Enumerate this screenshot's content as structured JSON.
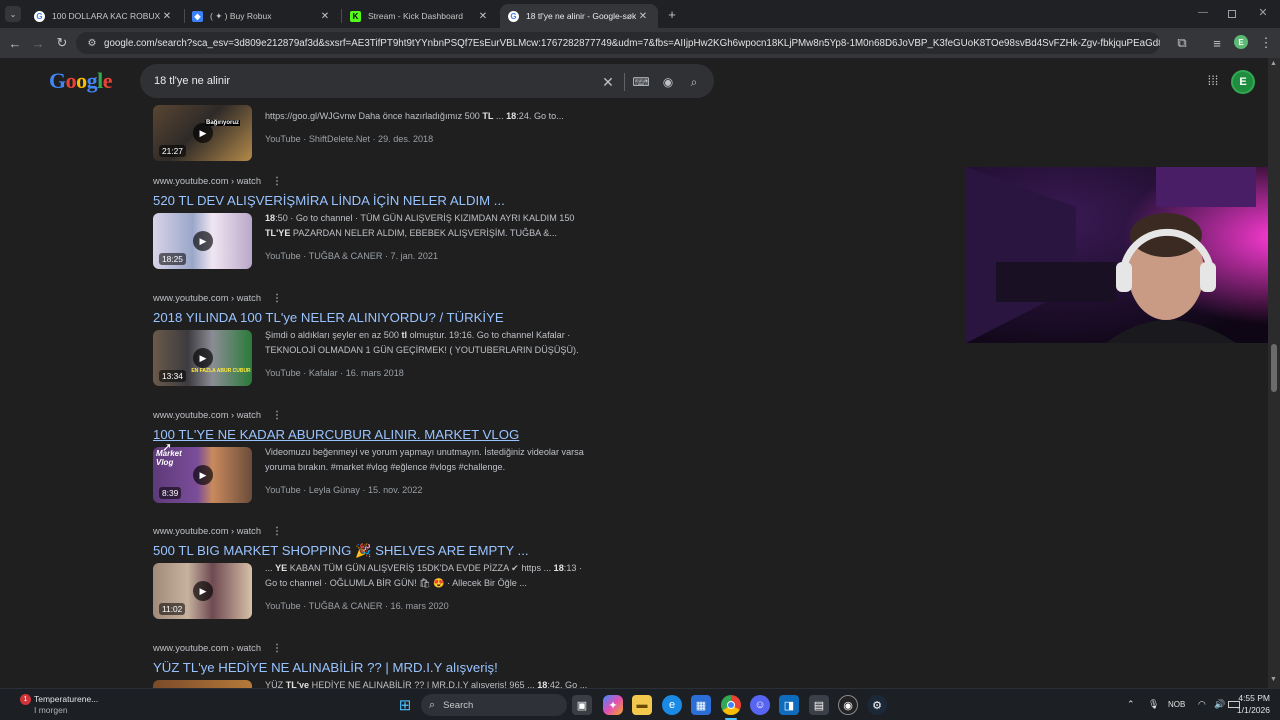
{
  "browser": {
    "tabs": [
      {
        "title": "100 DOLLARA KAC ROBUX ALIN",
        "active": false
      },
      {
        "title": "( ✦ ) Buy Robux",
        "active": false
      },
      {
        "title": "Stream - Kick Dashboard",
        "active": false
      },
      {
        "title": "18 tl'ye ne alinir - Google-søk",
        "active": true
      }
    ],
    "url": "google.com/search?sca_esv=3d809e212879af3d&sxsrf=AE3TifPT9ht9tYYnbnPSQf7EsEurVBLMcw:1767282877749&udm=7&fbs=AIIjpHw2KGh6wpocn18KLjPMw8n5Yp8-1M0n68D6JoVBP_K3feGUoK8TOe98svBd4SvFZHk-Zgv-fbkjquPEaGd8Tf9HQ0lH8...",
    "profile_initial": "E"
  },
  "google": {
    "logo": "Google",
    "query": "18 tl'ye ne alinir"
  },
  "results": [
    {
      "snippet_html": "https://goo.gl/WJGvnw Daha önce hazırladığımız 500 <b>TL</b> ... <b>18</b>:24. Go to...",
      "channel": "YouTube · ShiftDelete.Net · 29. des. 2018",
      "duration": "21:27",
      "thumb_label": "Bağırıyoruz"
    },
    {
      "source": "www.youtube.com › watch",
      "title": "520 TL DEV ALIŞVERİŞMİRA LİNDA İÇİN NELER ALDIM ...",
      "snippet_html": "<b>18</b>:50 · Go to channel · TÜM GÜN ALIŞVERİŞ KIZIMDAN AYRI KALDIM 150 <b>TL'YE</b> PAZARDAN NELER ALDIM, EBEBEK ALIŞVERİŞİM. TUĞBA &...",
      "channel": "YouTube · TUĞBA &amp; CANER · 7. jan. 2021",
      "duration": "18:25"
    },
    {
      "source": "www.youtube.com › watch",
      "title": "2018 YILINDA 100 TL'ye NELER ALINIYORDU? / TÜRKİYE",
      "snippet_html": "Şimdi o aldıkları şeyler en az 500 <b>tl</b> olmuştur. 19:16. Go to channel Kafalar · TEKNOLOJİ OLMADAN 1 GÜN GEÇİRMEK! ( YOUTUBERLARIN DÜŞÜŞÜ).",
      "channel": "YouTube · Kafalar · 16. mars 2018",
      "duration": "13:34",
      "thumb_label": "EN FAZLA ABUR CUBUR"
    },
    {
      "source": "www.youtube.com › watch",
      "title": "100 TL'YE NE KADAR ABURCUBUR ALINIR. MARKET VLOG",
      "snippet_html": "Videomuzu beğenmeyi ve yorum yapmayı unutmayın. İstediğiniz videolar varsa yoruma bırakın. #market #vlog #eğlence #vlogs #challenge.",
      "channel": "YouTube · Leyla Günay · 15. nov. 2022",
      "duration": "8:39",
      "thumb_label": "Market Vlog"
    },
    {
      "source": "www.youtube.com › watch",
      "title": "500 TL BIG MARKET SHOPPING 🎉 SHELVES ARE EMPTY ...",
      "snippet_html": "... <b>YE</b> KABAN TÜM GÜN ALIŞVERİŞ 15DK'DA EVDE PİZZA ✔ https ... <b>18</b>:13 · Go to channel · OĞLUMLA BİR GÜN! 🛍 😍 · Allecek Bir Öğle ...",
      "channel": "YouTube · TUĞBA &amp; CANER · 16. mars 2020",
      "duration": "11:02"
    },
    {
      "source": "www.youtube.com › watch",
      "title": "YÜZ TL'ye HEDİYE NE ALINABİLİR ?? | MRD.I.Y alışveriş!",
      "snippet_html": "YÜZ <b>TL'ye</b> HEDİYE NE ALINABİLİR ?? | MR.D.I.Y alışveriş! 965 ... <b>18</b>:42. Go ..."
    }
  ],
  "taskbar": {
    "weather_title": "Temperaturene...",
    "weather_sub": "I morgen",
    "weather_badge": "1",
    "search_label": "Search",
    "lang": "NOB",
    "time": "4:55 PM",
    "date": "1/1/2026"
  },
  "colors": {
    "accent_link": "#99c3ff",
    "bg": "#1f1f1f",
    "visited": "#c58af9"
  }
}
